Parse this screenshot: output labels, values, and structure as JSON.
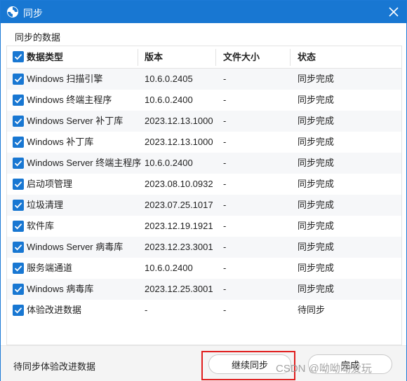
{
  "window": {
    "title": "同步"
  },
  "subheader": "同步的数据",
  "columns": [
    "数据类型",
    "版本",
    "文件大小",
    "状态"
  ],
  "rows": [
    {
      "name": "Windows 扫描引擎",
      "version": "10.6.0.2405",
      "size": "-",
      "status": "同步完成"
    },
    {
      "name": "Windows 终端主程序",
      "version": "10.6.0.2400",
      "size": "-",
      "status": "同步完成"
    },
    {
      "name": "Windows Server 补丁库",
      "version": "2023.12.13.1000",
      "size": "-",
      "status": "同步完成"
    },
    {
      "name": "Windows 补丁库",
      "version": "2023.12.13.1000",
      "size": "-",
      "status": "同步完成"
    },
    {
      "name": "Windows Server 终端主程序",
      "version": "10.6.0.2400",
      "size": "-",
      "status": "同步完成"
    },
    {
      "name": "启动项管理",
      "version": "2023.08.10.0932",
      "size": "-",
      "status": "同步完成"
    },
    {
      "name": "垃圾清理",
      "version": "2023.07.25.1017",
      "size": "-",
      "status": "同步完成"
    },
    {
      "name": "软件库",
      "version": "2023.12.19.1921",
      "size": "-",
      "status": "同步完成"
    },
    {
      "name": "Windows Server 病毒库",
      "version": "2023.12.23.3001",
      "size": "-",
      "status": "同步完成"
    },
    {
      "name": "服务端通道",
      "version": "10.6.0.2400",
      "size": "-",
      "status": "同步完成"
    },
    {
      "name": "Windows 病毒库",
      "version": "2023.12.25.3001",
      "size": "-",
      "status": "同步完成"
    },
    {
      "name": "体验改进数据",
      "version": "-",
      "size": "-",
      "status": "待同步"
    }
  ],
  "footer": {
    "status_text": "待同步体验改进数据",
    "continue_label": "继续同步",
    "done_label": "完成"
  },
  "watermark": "CSDN @呦呦呦爱玩",
  "colors": {
    "titlebar": "#1877d2",
    "checkbox": "#1877d2",
    "highlight": "#e01e1e"
  }
}
